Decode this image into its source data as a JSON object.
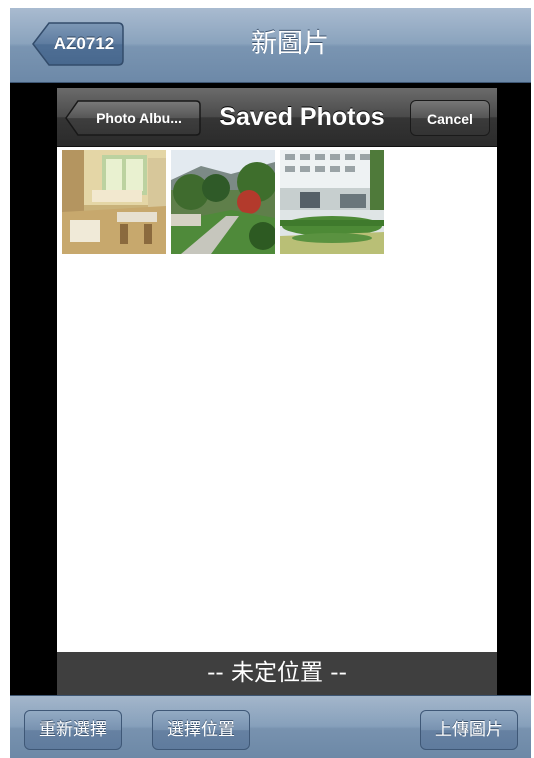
{
  "navbar": {
    "back_label": "AZ0712",
    "title": "新圖片"
  },
  "picker": {
    "back_label": "Photo Albu...",
    "title": "Saved Photos",
    "cancel_label": "Cancel",
    "photos": [
      "interior-photo",
      "garden-photo",
      "building-photo"
    ]
  },
  "status": {
    "text": "-- 未定位置 --"
  },
  "toolbar": {
    "reselect_label": "重新選擇",
    "choose_location_label": "選擇位置",
    "upload_label": "上傳圖片"
  },
  "colors": {
    "navbar": "#8aa3bd",
    "picker_nav": "#3a3a3a",
    "status_bar": "#3f3f3f"
  }
}
